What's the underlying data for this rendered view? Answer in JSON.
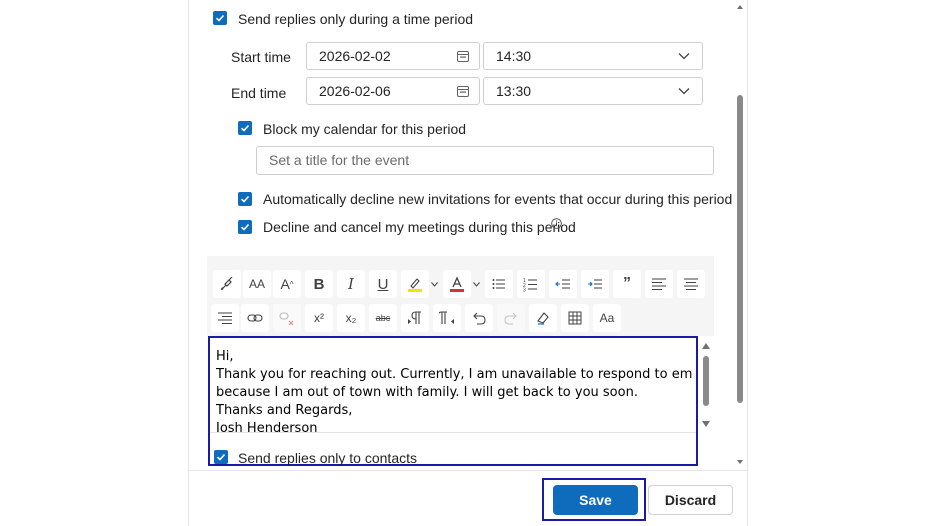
{
  "time_period": {
    "checkbox_label": "Send replies only during a time period",
    "start_label": "Start time",
    "start_date": "2026-02-02",
    "start_time": "14:30",
    "end_label": "End time",
    "end_date": "2026-02-06",
    "end_time": "13:30"
  },
  "options": {
    "block_calendar": "Block my calendar for this period",
    "event_title_placeholder": "Set a title for the event",
    "auto_decline": "Automatically decline new invitations for events that occur during this period",
    "decline_cancel": "Decline and cancel my meetings during this period"
  },
  "toolbar": {
    "font_size_label": "AA",
    "grow_font_label": "A",
    "bold_label": "B",
    "italic_label": "I",
    "underline_label": "U",
    "font_color_label": "A",
    "quote_label": "”",
    "superscript_label": "x²",
    "subscript_label": "x₂",
    "strike_label": "abc",
    "change_case_label": "Aa",
    "highlight_color": "#f5e400",
    "font_color": "#d13438"
  },
  "message": {
    "lines": [
      "Hi,",
      "Thank you for reaching out. Currently, I am unavailable to respond to emails",
      "because I am out of town with family. I will get back to you soon.",
      "Thanks and Regards,",
      "Josh Henderson"
    ],
    "contacts_only": "Send replies only to contacts"
  },
  "footer": {
    "save_label": "Save",
    "discard_label": "Discard"
  },
  "colors": {
    "accent": "#0f6cbd",
    "highlight_outline": "#1a1aa6"
  }
}
